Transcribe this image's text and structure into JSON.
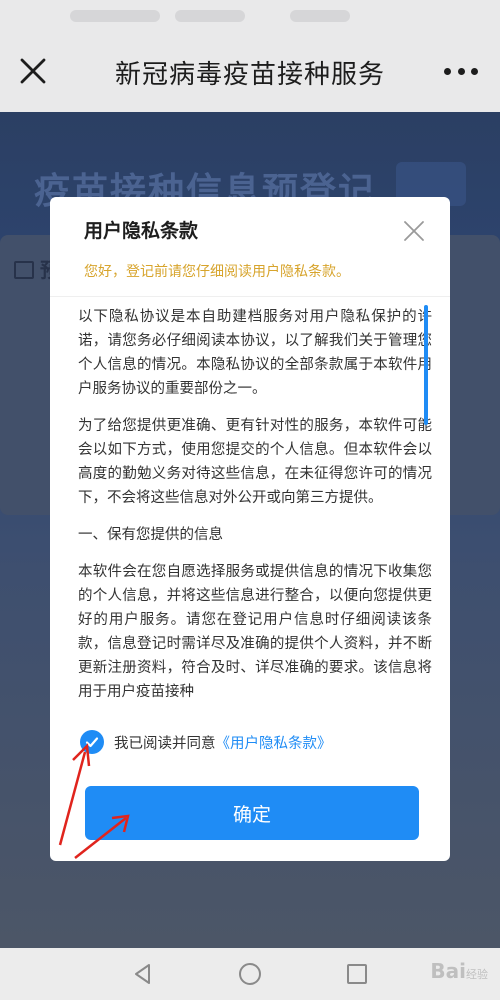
{
  "nav": {
    "title": "新冠病毒疫苗接种服务"
  },
  "background": {
    "banner": "疫苗接种信息预登记",
    "card_label": "预"
  },
  "modal": {
    "title": "用户隐私条款",
    "hint": "您好，登记前请您仔细阅读用户隐私条款。",
    "paragraphs": [
      "以下隐私协议是本自助建档服务对用户隐私保护的许诺，请您务必仔细阅读本协议，以了解我们关于管理您个人信息的情况。本隐私协议的全部条款属于本软件用户服务协议的重要部份之一。",
      "为了给您提供更准确、更有针对性的服务，本软件可能会以如下方式，使用您提交的个人信息。但本软件会以高度的勤勉义务对待这些信息，在未征得您许可的情况下，不会将这些信息对外公开或向第三方提供。",
      "一、保有您提供的信息",
      "本软件会在您自愿选择服务或提供信息的情况下收集您的个人信息，并将这些信息进行整合，以便向您提供更好的用户服务。请您在登记用户信息时仔细阅读该条款，信息登记时需详尽及准确的提供个人资料，并不断更新注册资料，符合及时、详尽准确的要求。该信息将用于用户疫苗接种"
    ],
    "agree_text": "我已阅读并同意",
    "agree_link": "《用户隐私条款》",
    "agree_checked": true,
    "confirm_label": "确定"
  },
  "watermark": {
    "brand": "Bai",
    "sub": "经验"
  },
  "colors": {
    "accent": "#1f8cf5",
    "hint": "#d7a42c",
    "annotation_arrow": "#e0241d"
  }
}
